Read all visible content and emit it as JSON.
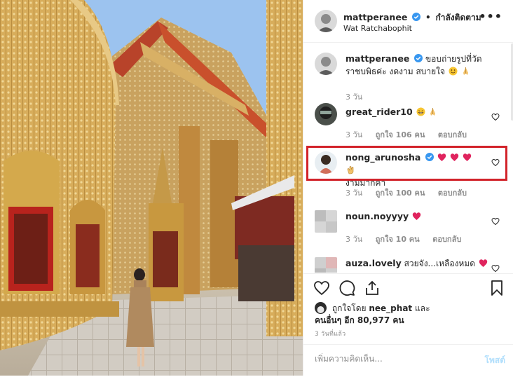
{
  "header": {
    "username": "mattperanee",
    "follow_label": "กำลังติดตาม",
    "location": "Wat Ratchabophit",
    "more_label": "•••"
  },
  "caption": {
    "username": "mattperanee",
    "text": "ขอบถ่ายรูปที่วัดราชบพิธค่ะ งดงาม สบายใจ",
    "time": "3 วัน"
  },
  "comments": [
    {
      "username": "great_rider10",
      "text": "",
      "emojis": [
        "grin-emoji",
        "pray-emoji"
      ],
      "time": "3 วัน",
      "likes": "ถูกใจ 106 คน",
      "reply": "ตอบกลับ"
    },
    {
      "username": "nong_arunosha",
      "verified": true,
      "text": "งามมากค่า",
      "emojis": [
        "red-heart-emoji",
        "red-heart-emoji",
        "red-heart-emoji",
        "clap-emoji"
      ],
      "time": "3 วัน",
      "likes": "ถูกใจ 100 คน",
      "reply": "ตอบกลับ"
    },
    {
      "username": "noun.noyyyy",
      "text": "",
      "emojis": [
        "red-heart-emoji"
      ],
      "time": "3 วัน",
      "likes": "ถูกใจ 10 คน",
      "reply": "ตอบกลับ"
    },
    {
      "username": "auza.lovely",
      "text": "สวยจัง...เหลืองหมด",
      "emojis": [
        "red-heart-emoji"
      ],
      "time": "",
      "likes": "",
      "reply": ""
    }
  ],
  "likes": {
    "prefix": "ถูกใจโดย",
    "first_user": "nee_phat",
    "and": "และ",
    "others": "คนอื่นๆ อีก 80,977 คน"
  },
  "timestamp": "3 วันที่แล้ว",
  "add_comment": {
    "placeholder": "เพิ่มความคิดเห็น...",
    "post_label": "โพสต์"
  },
  "colors": {
    "verified": "#3897f0",
    "highlight": "#d2232a",
    "muted": "#8e8e8e",
    "post_disabled": "#b2dffc"
  }
}
